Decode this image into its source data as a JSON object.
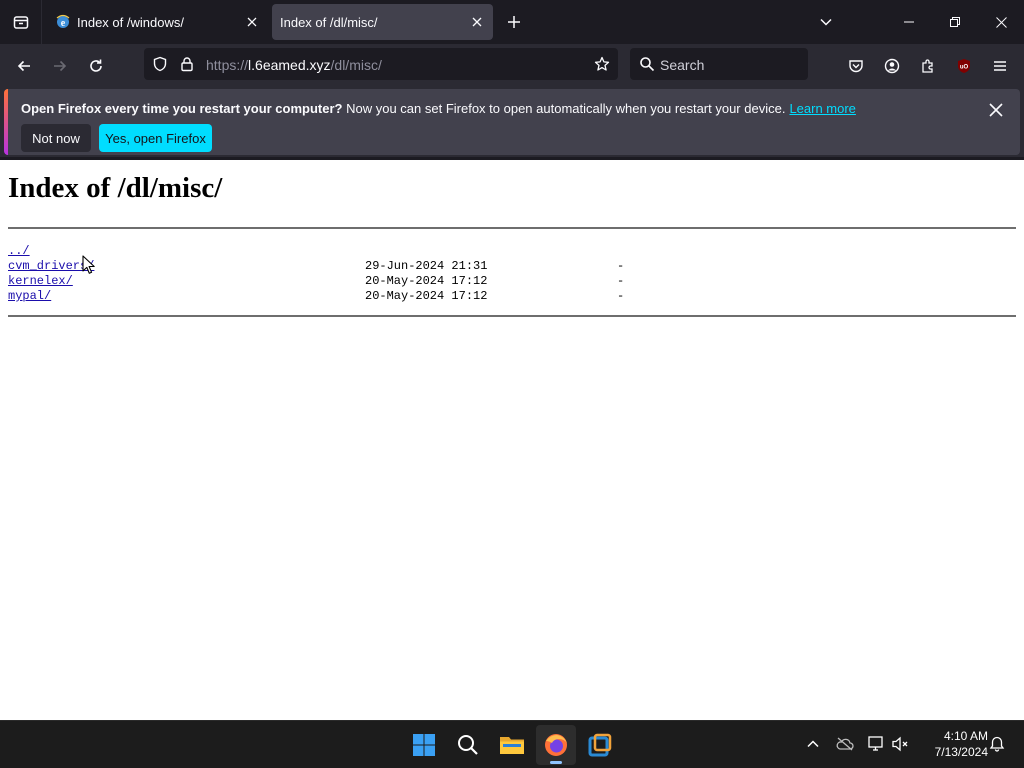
{
  "browser": {
    "tabs": [
      {
        "title": "Index of /windows/",
        "active": false
      },
      {
        "title": "Index of /dl/misc/",
        "active": true
      }
    ],
    "url": {
      "scheme": "https://",
      "host": "l.6eamed.xyz",
      "path": "/dl/misc/"
    },
    "search_placeholder": "Search"
  },
  "notification": {
    "title": "Open Firefox every time you restart your computer?",
    "body": "Now you can set Firefox to open automatically when you restart your device.",
    "learn_more": "Learn more",
    "not_now": "Not now",
    "yes_button": "Yes, open Firefox"
  },
  "page": {
    "heading": "Index of /dl/misc/",
    "entries": [
      {
        "name": "../",
        "date": "",
        "size": ""
      },
      {
        "name": "cvm_drivers/",
        "date": "29-Jun-2024 21:31",
        "size": "-"
      },
      {
        "name": "kernelex/",
        "date": "20-May-2024 17:12",
        "size": "-"
      },
      {
        "name": "mypal/",
        "date": "20-May-2024 17:12",
        "size": "-"
      }
    ]
  },
  "taskbar": {
    "time": "4:10 AM",
    "date": "7/13/2024",
    "apps": [
      "windows-start-icon",
      "search-icon",
      "file-explorer-icon",
      "firefox-icon",
      "virtualbox-icon"
    ]
  },
  "colors": {
    "accent": "#00ddff",
    "toolbar": "#2b2a33",
    "tabstrip": "#1c1b22",
    "link": "#1a0dab"
  }
}
